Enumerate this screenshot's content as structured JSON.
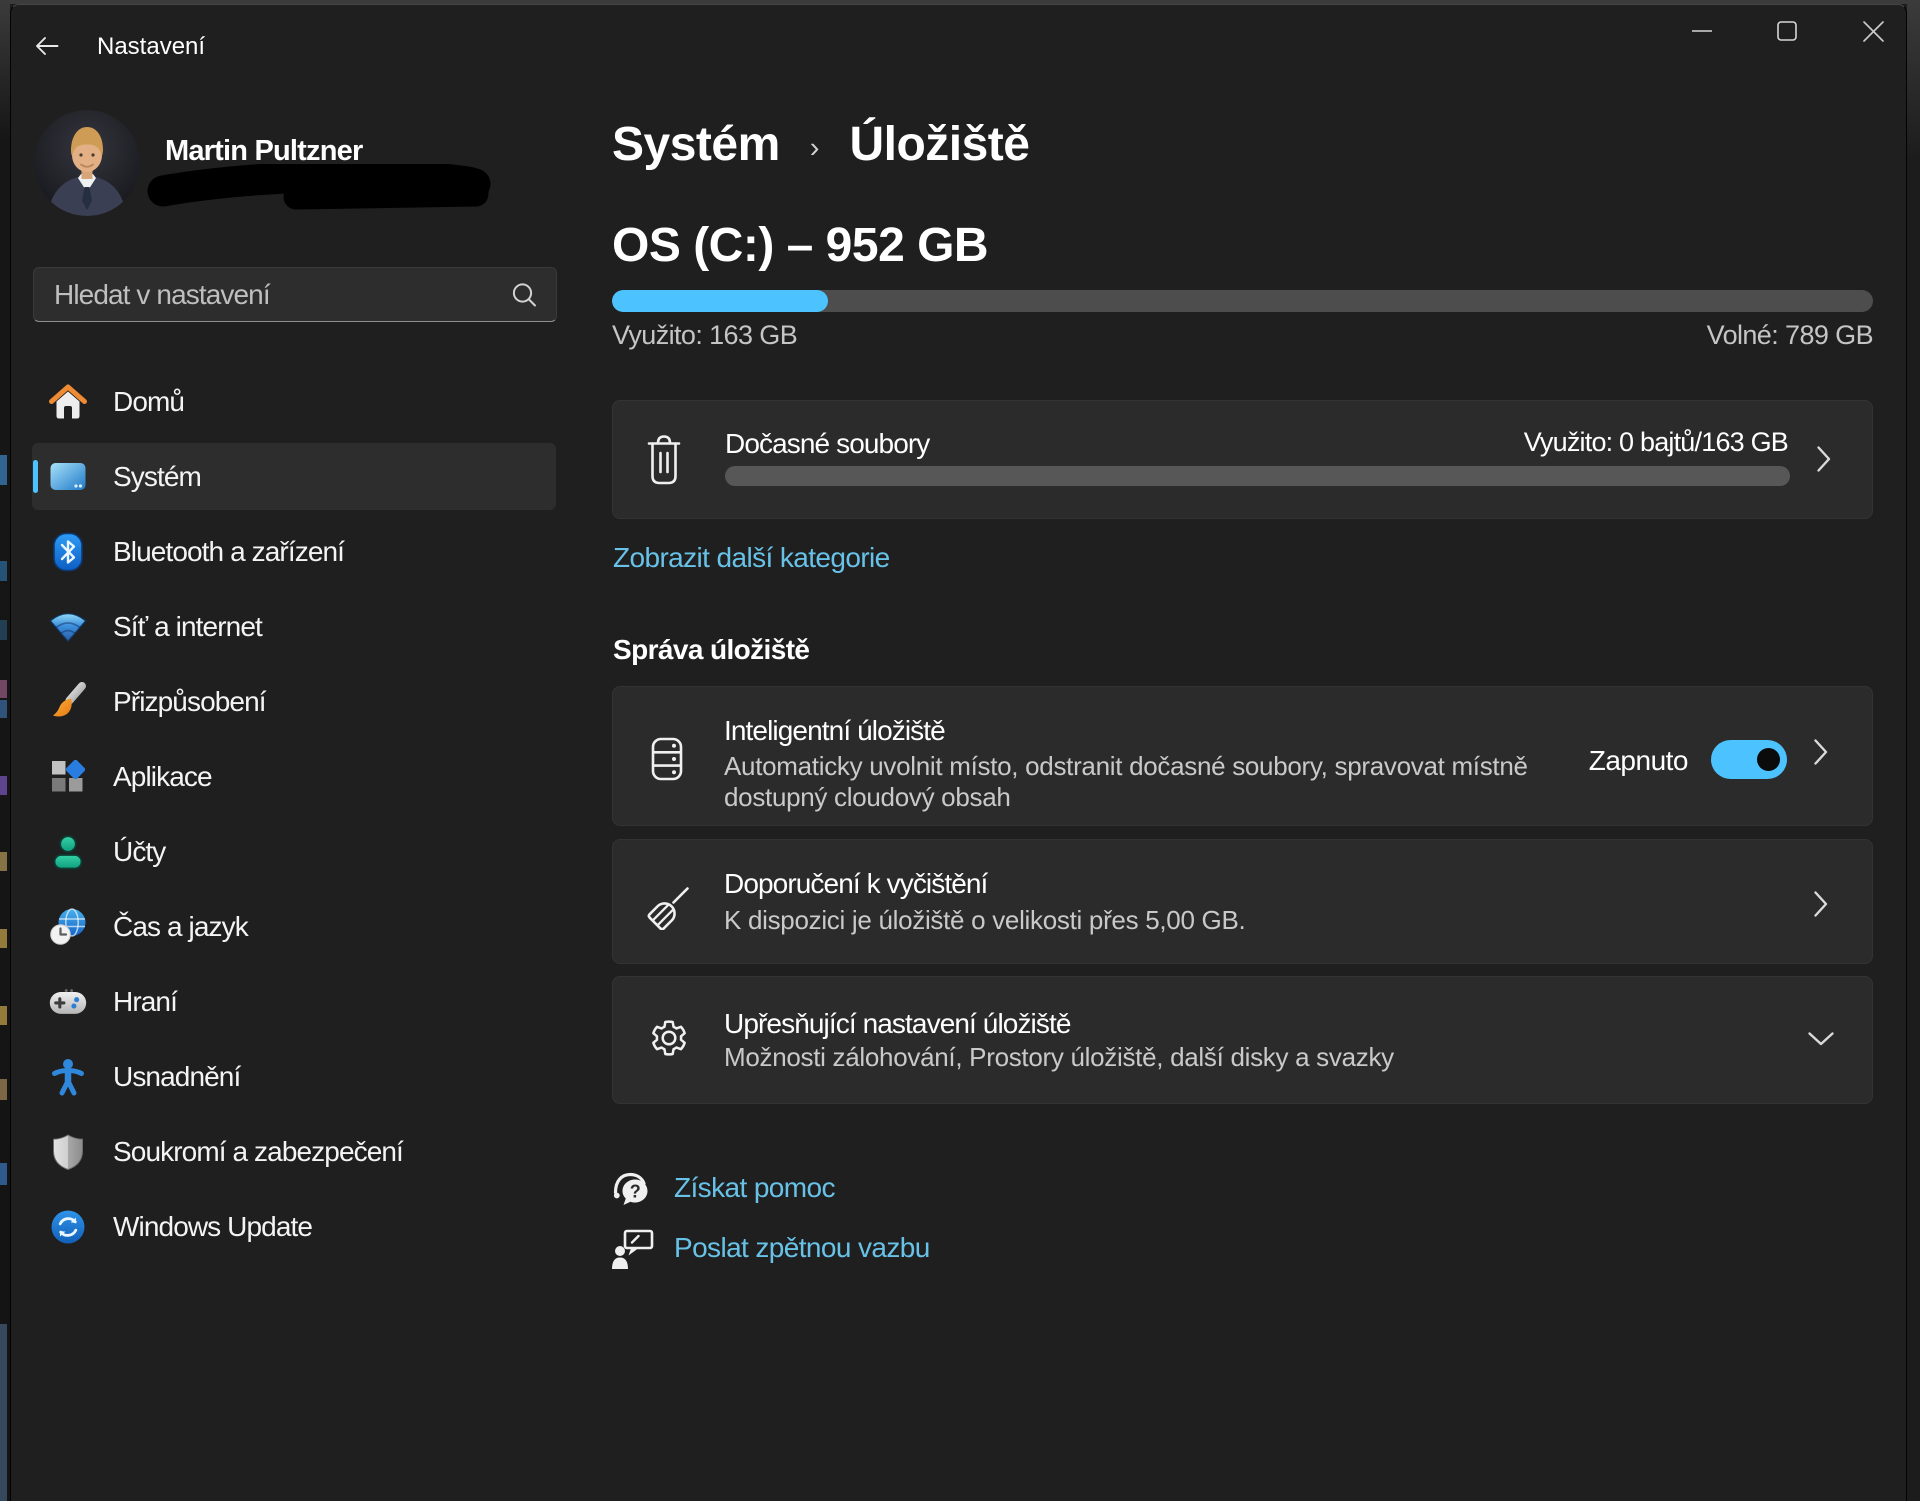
{
  "titlebar": {
    "app_title": "Nastavení"
  },
  "user": {
    "name": "Martin Pultzner"
  },
  "search": {
    "placeholder": "Hledat v nastavení"
  },
  "sidebar": {
    "items": [
      {
        "label": "Domů",
        "icon": "home"
      },
      {
        "label": "Systém",
        "icon": "system",
        "selected": true
      },
      {
        "label": "Bluetooth a zařízení",
        "icon": "bluetooth"
      },
      {
        "label": "Síť a internet",
        "icon": "network"
      },
      {
        "label": "Přizpůsobení",
        "icon": "personalization"
      },
      {
        "label": "Aplikace",
        "icon": "apps"
      },
      {
        "label": "Účty",
        "icon": "accounts"
      },
      {
        "label": "Čas a jazyk",
        "icon": "time-language"
      },
      {
        "label": "Hraní",
        "icon": "gaming"
      },
      {
        "label": "Usnadnění",
        "icon": "accessibility"
      },
      {
        "label": "Soukromí a zabezpečení",
        "icon": "privacy"
      },
      {
        "label": "Windows Update",
        "icon": "windows-update"
      }
    ]
  },
  "main": {
    "breadcrumb": {
      "parent": "Systém",
      "separator": "›",
      "current": "Úložiště"
    },
    "drive": {
      "title": "OS (C:) – 952 GB",
      "used_label": "Využito: 163 GB",
      "free_label": "Volné: 789 GB",
      "used_percent": "17.1"
    },
    "temp_files": {
      "title": "Dočasné soubory",
      "usage_label": "Využito: 0 bajtů/163 GB",
      "used_percent": "0"
    },
    "show_more_label": "Zobrazit další kategorie",
    "section_title": "Správa úložiště",
    "storage_sense": {
      "title": "Inteligentní úložiště",
      "description": "Automaticky uvolnit místo, odstranit dočasné soubory, spravovat místně dostupný cloudový obsah",
      "toggle_label": "Zapnuto",
      "toggle_on": true
    },
    "cleanup": {
      "title": "Doporučení k vyčištění",
      "description": "K dispozici je úložiště o velikosti přes 5,00 GB."
    },
    "advanced": {
      "title": "Upřesňující nastavení úložiště",
      "description": "Možnosti zálohování, Prostory úložiště, další disky a svazky"
    },
    "links": {
      "help": "Získat pomoc",
      "feedback": "Poslat zpětnou vazbu"
    }
  },
  "colors": {
    "accent": "#4cc2ff",
    "link": "#68c2e8"
  }
}
